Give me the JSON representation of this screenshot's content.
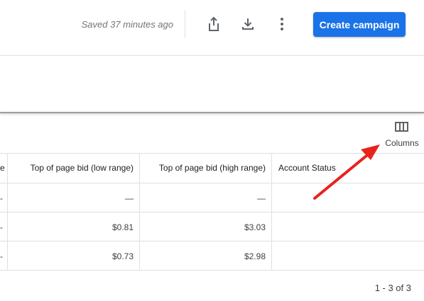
{
  "toolbar": {
    "saved_status": "Saved 37 minutes ago",
    "share_icon": "share-icon",
    "download_icon": "download-icon",
    "more_icon": "more-vert-icon",
    "create_label": "Create campaign"
  },
  "columns_control": {
    "label": "Columns",
    "icon": "columns-icon"
  },
  "table": {
    "partial_header": "e",
    "headers": [
      "Top of page bid (low range)",
      "Top of page bid (high range)",
      "Account Status"
    ],
    "rows": [
      {
        "partial": "-",
        "low": "—",
        "high": "—",
        "status": ""
      },
      {
        "partial": "-",
        "low": "$0.81",
        "high": "$3.03",
        "status": ""
      },
      {
        "partial": "-",
        "low": "$0.73",
        "high": "$2.98",
        "status": ""
      }
    ]
  },
  "pagination": {
    "text": "1 - 3 of 3"
  },
  "colors": {
    "primary": "#1a73e8",
    "annotation_arrow": "#e8231b"
  }
}
